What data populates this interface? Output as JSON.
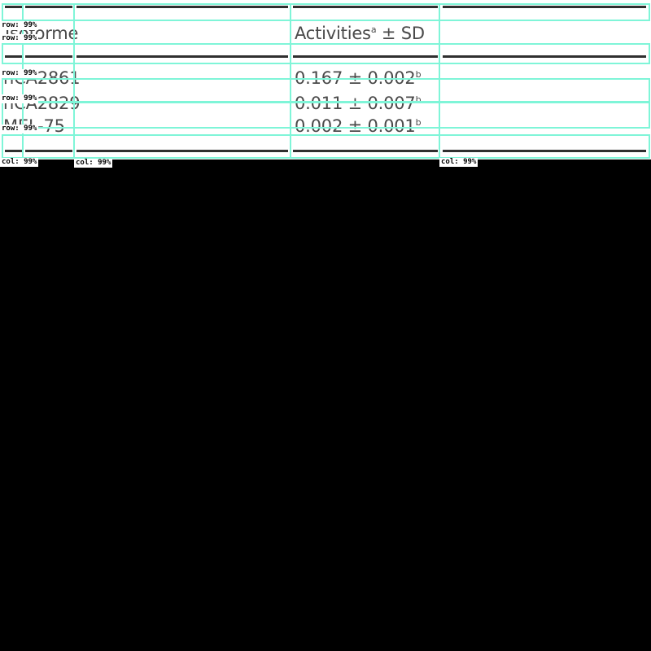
{
  "table": {
    "header": {
      "name_label": "Isoforme",
      "activity_label": "Activities",
      "activity_sup": "a",
      "activity_suffix": " ± SD"
    },
    "rows": [
      {
        "name": "hCA2861",
        "value": "0.167 ± 0.002",
        "sup": "b"
      },
      {
        "name": "hCA2829",
        "value": "0.011 ± 0.007",
        "sup": "b"
      },
      {
        "name": "MEL-75",
        "value": "0.002 ± 0.001",
        "sup": "b"
      }
    ]
  },
  "detections": {
    "row_label": "row: 99%",
    "col_label": "col: 99%",
    "box_color": "#7ff5d8"
  }
}
